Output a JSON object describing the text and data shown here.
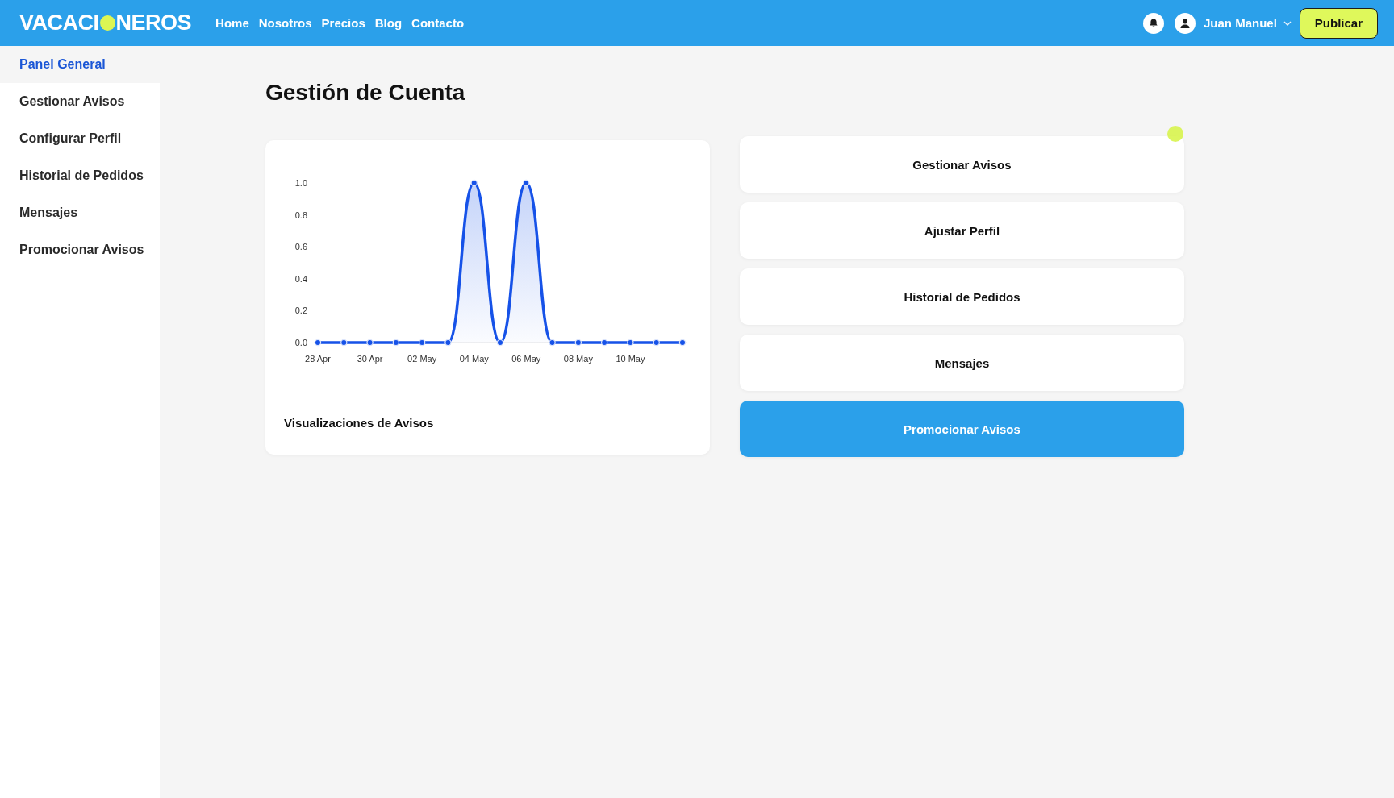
{
  "header": {
    "logo": {
      "before": "VACACI",
      "after": "NEROS"
    },
    "nav": [
      "Home",
      "Nosotros",
      "Precios",
      "Blog",
      "Contacto"
    ],
    "user": "Juan Manuel",
    "publish": "Publicar"
  },
  "sidebar": {
    "items": [
      {
        "label": "Panel General",
        "selected": true
      },
      {
        "label": "Gestionar Avisos",
        "selected": false
      },
      {
        "label": "Configurar Perfil",
        "selected": false
      },
      {
        "label": "Historial de Pedidos",
        "selected": false
      },
      {
        "label": "Mensajes",
        "selected": false
      },
      {
        "label": "Promocionar Avisos",
        "selected": false
      }
    ]
  },
  "page_title": "Gestión de Cuenta",
  "chart_card": {
    "title": "Visualizaciones de Avisos",
    "chart_data": {
      "type": "area",
      "categories": [
        "28 Apr",
        null,
        "30 Apr",
        null,
        "02 May",
        null,
        "04 May",
        null,
        "06 May",
        null,
        "08 May",
        null,
        "10 May",
        null,
        null
      ],
      "series": [
        {
          "color": "#1652e8",
          "values": [
            0,
            0,
            0,
            0,
            0,
            0,
            1,
            0,
            1,
            0,
            0,
            0,
            0,
            0,
            0
          ]
        }
      ],
      "ylim": [
        0,
        1
      ],
      "yticks": [
        {
          "value": 0,
          "label": "0.0"
        },
        {
          "value": 0.2,
          "label": "0.2"
        },
        {
          "value": 0.4,
          "label": "0.4"
        },
        {
          "value": 0.6,
          "label": "0.6"
        },
        {
          "value": 0.8,
          "label": "0.8"
        },
        {
          "value": 1,
          "label": "1.0"
        }
      ]
    }
  },
  "actions": [
    {
      "label": "Gestionar Avisos",
      "kind": "plain"
    },
    {
      "label": "Ajustar Perfil",
      "kind": "plain"
    },
    {
      "label": "Historial de Pedidos",
      "kind": "plain"
    },
    {
      "label": "Mensajes",
      "kind": "plain"
    },
    {
      "label": "Promocionar Avisos",
      "kind": "primary"
    }
  ]
}
